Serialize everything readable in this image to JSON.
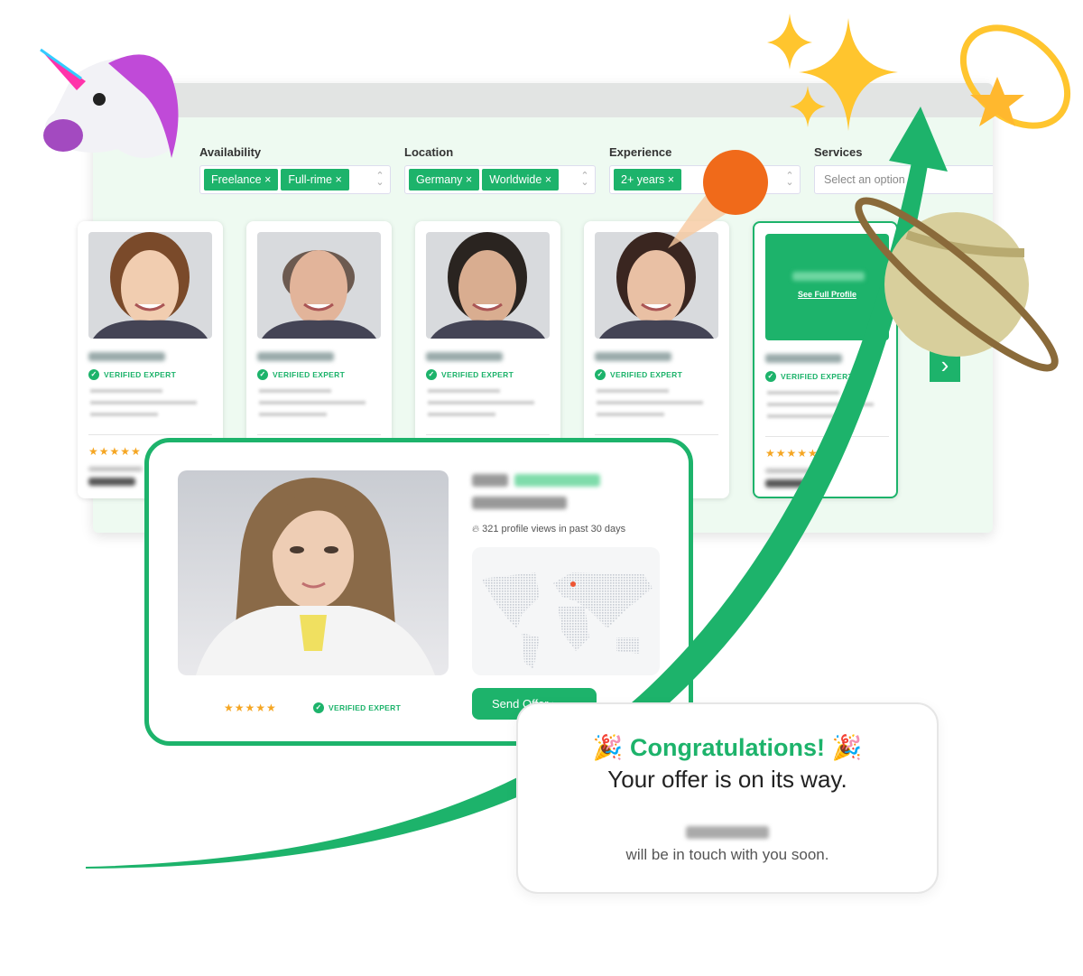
{
  "filters": [
    {
      "label": "Availability",
      "chips": [
        "Freelance",
        "Full-rime"
      ]
    },
    {
      "label": "Location",
      "chips": [
        "Germany",
        "Worldwide"
      ]
    },
    {
      "label": "Experience",
      "chips": [
        "2+ years"
      ]
    },
    {
      "label": "Services",
      "chips": [],
      "placeholder": "Select an option"
    }
  ],
  "chip_remove": "×",
  "cards": {
    "verified_label": "VERIFIED EXPERT",
    "stars": "★★★★★",
    "full_profile_label": "See Full Profile"
  },
  "next_icon": "chevron-right-icon",
  "profile": {
    "views": "321 profile views in past 30 days",
    "verified_label": "VERIFIED EXPERT",
    "stars": "★★★★★",
    "send_label": "Send Offer",
    "send_arrow": "›"
  },
  "congrats": {
    "title": "Congratulations!",
    "subtitle": "Your offer is on its way.",
    "message": "will be in touch with you soon."
  },
  "colors": {
    "accent": "#1db36b",
    "star": "#f5a623",
    "background": "#eefaf1"
  }
}
